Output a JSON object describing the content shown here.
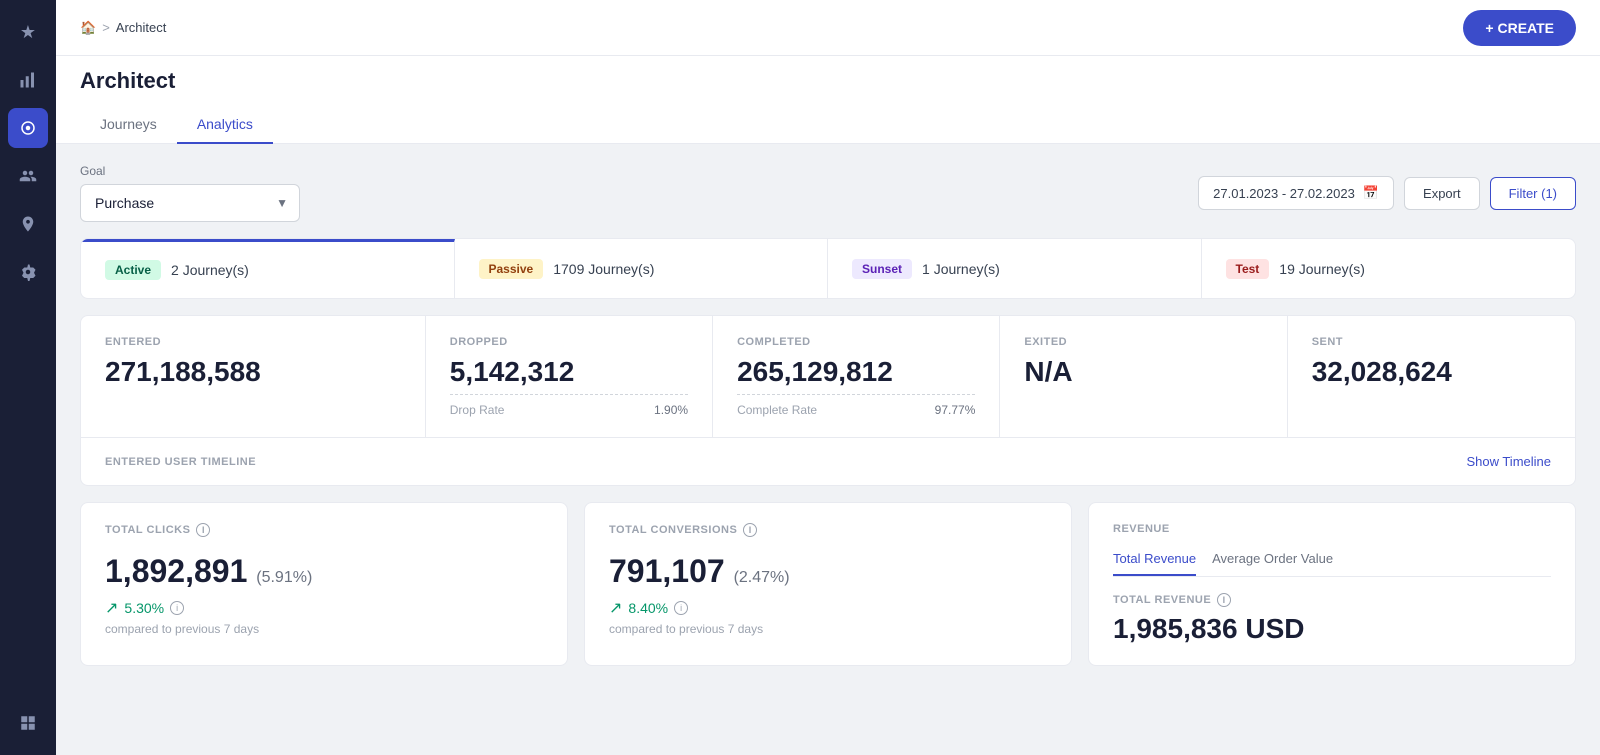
{
  "sidebar": {
    "items": [
      {
        "name": "star-icon",
        "symbol": "★",
        "active": false
      },
      {
        "name": "analytics-icon",
        "symbol": "▦",
        "active": false
      },
      {
        "name": "journey-icon",
        "symbol": "◉",
        "active": true
      },
      {
        "name": "users-icon",
        "symbol": "👥",
        "active": false
      },
      {
        "name": "location-icon",
        "symbol": "📍",
        "active": false
      },
      {
        "name": "more-icon",
        "symbol": "⋯",
        "active": false
      },
      {
        "name": "grid-icon",
        "symbol": "⊞",
        "active": false
      }
    ]
  },
  "topbar": {
    "home_icon": "🏠",
    "breadcrumb_sep": ">",
    "breadcrumb_current": "Architect",
    "create_label": "+ CREATE"
  },
  "page": {
    "title": "Architect",
    "tabs": [
      {
        "label": "Journeys",
        "active": false
      },
      {
        "label": "Analytics",
        "active": true
      }
    ]
  },
  "filters": {
    "goal_label": "Goal",
    "goal_value": "Purchase",
    "goal_placeholder": "Purchase",
    "date_range": "27.01.2023 - 27.02.2023",
    "export_label": "Export",
    "filter_label": "Filter (1)"
  },
  "journey_statuses": [
    {
      "badge": "Active",
      "badge_class": "badge-active",
      "count": "2 Journey(s)",
      "active_card": true
    },
    {
      "badge": "Passive",
      "badge_class": "badge-passive",
      "count": "1709 Journey(s)",
      "active_card": false
    },
    {
      "badge": "Sunset",
      "badge_class": "badge-sunset",
      "count": "1 Journey(s)",
      "active_card": false
    },
    {
      "badge": "Test",
      "badge_class": "badge-test",
      "count": "19 Journey(s)",
      "active_card": false
    }
  ],
  "stats": [
    {
      "label": "ENTERED",
      "value": "271,188,588",
      "sub": []
    },
    {
      "label": "DROPPED",
      "value": "5,142,312",
      "sub": [
        {
          "left": "Drop Rate",
          "right": "1.90%"
        }
      ]
    },
    {
      "label": "COMPLETED",
      "value": "265,129,812",
      "sub": [
        {
          "left": "Complete Rate",
          "right": "97.77%"
        }
      ]
    },
    {
      "label": "EXITED",
      "value": "N/A",
      "sub": []
    },
    {
      "label": "SENT",
      "value": "32,028,624",
      "sub": []
    }
  ],
  "timeline": {
    "label": "ENTERED USER TIMELINE",
    "show_link": "Show Timeline"
  },
  "metrics": [
    {
      "title": "TOTAL CLICKS",
      "value": "1,892,891",
      "pct": "(5.91%)",
      "change": "5.30%",
      "change_positive": true,
      "compare": "compared to previous 7 days"
    },
    {
      "title": "TOTAL CONVERSIONS",
      "value": "791,107",
      "pct": "(2.47%)",
      "change": "8.40%",
      "change_positive": true,
      "compare": "compared to previous 7 days"
    }
  ],
  "revenue": {
    "title": "REVENUE",
    "tabs": [
      "Total Revenue",
      "Average Order Value"
    ],
    "active_tab": "Total Revenue",
    "sub_label": "Total Revenue",
    "value": "1,985,836 USD"
  }
}
